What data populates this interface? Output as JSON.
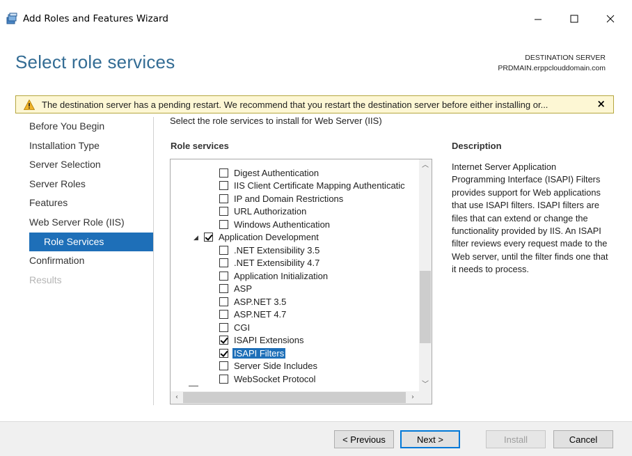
{
  "window": {
    "title": "Add Roles and Features Wizard",
    "minimize": "—",
    "maximize": "☐",
    "close": "✕"
  },
  "header": {
    "heading": "Select role services",
    "dest_label": "DESTINATION SERVER",
    "dest_server": "PRDMAIN.erppclouddomain.com"
  },
  "warning": {
    "text": "The destination server has a pending restart. We recommend that you restart the destination server before either installing or...",
    "close": "×"
  },
  "nav": {
    "items": [
      {
        "label": "Before You Begin"
      },
      {
        "label": "Installation Type"
      },
      {
        "label": "Server Selection"
      },
      {
        "label": "Server Roles"
      },
      {
        "label": "Features"
      },
      {
        "label": "Web Server Role (IIS)"
      },
      {
        "label": "Role Services"
      },
      {
        "label": "Confirmation"
      },
      {
        "label": "Results"
      }
    ],
    "active_index": 6
  },
  "main": {
    "intro": "Select the role services to install for Web Server (IIS)",
    "role_services_header": "Role services",
    "description_header": "Description",
    "description": "Internet Server Application Programming Interface (ISAPI) Filters provides support for Web applications that use ISAPI filters. ISAPI filters are files that can extend or change the functionality provided by IIS. An ISAPI filter reviews every request made to the Web server, until the filter finds one that it needs to process."
  },
  "tree": {
    "items": [
      {
        "label": "Digest Authentication",
        "checked": false,
        "level": 2
      },
      {
        "label": "IIS Client Certificate Mapping Authenticatic",
        "checked": false,
        "level": 2
      },
      {
        "label": "IP and Domain Restrictions",
        "checked": false,
        "level": 2
      },
      {
        "label": "URL Authorization",
        "checked": false,
        "level": 2
      },
      {
        "label": "Windows Authentication",
        "checked": false,
        "level": 2
      },
      {
        "label": "Application Development",
        "checked": true,
        "level": 1,
        "expanded": true
      },
      {
        "label": ".NET Extensibility 3.5",
        "checked": false,
        "level": 2
      },
      {
        "label": ".NET Extensibility 4.7",
        "checked": false,
        "level": 2
      },
      {
        "label": "Application Initialization",
        "checked": false,
        "level": 2
      },
      {
        "label": "ASP",
        "checked": false,
        "level": 2
      },
      {
        "label": "ASP.NET 3.5",
        "checked": false,
        "level": 2
      },
      {
        "label": "ASP.NET 4.7",
        "checked": false,
        "level": 2
      },
      {
        "label": "CGI",
        "checked": false,
        "level": 2
      },
      {
        "label": "ISAPI Extensions",
        "checked": true,
        "level": 2
      },
      {
        "label": "ISAPI Filters",
        "checked": true,
        "level": 2,
        "selected": true
      },
      {
        "label": "Server Side Includes",
        "checked": false,
        "level": 2
      },
      {
        "label": "WebSocket Protocol",
        "checked": false,
        "level": 2
      }
    ]
  },
  "footer": {
    "previous": "< Previous",
    "next": "Next >",
    "install": "Install",
    "cancel": "Cancel"
  },
  "colors": {
    "accent": "#1e6fb8",
    "heading": "#336c94",
    "warning_bg": "#fdf7d4"
  }
}
